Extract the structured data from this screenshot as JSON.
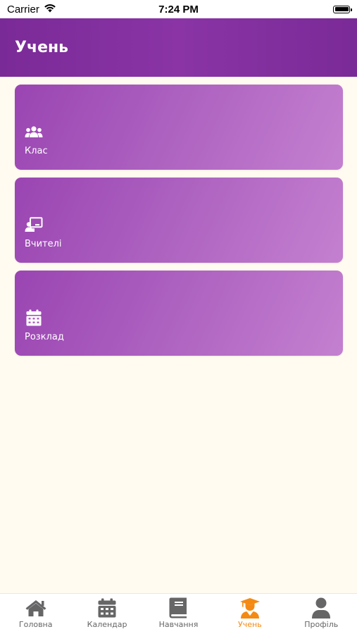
{
  "status_bar": {
    "carrier": "Carrier",
    "time": "7:24 PM"
  },
  "header": {
    "title": "Учень"
  },
  "cards": [
    {
      "label": "Клас",
      "icon": "users-icon"
    },
    {
      "label": "Вчителі",
      "icon": "teacher-board-icon"
    },
    {
      "label": "Розклад",
      "icon": "calendar-icon"
    }
  ],
  "tabbar": {
    "items": [
      {
        "label": "Головна",
        "icon": "home-icon",
        "active": false
      },
      {
        "label": "Календар",
        "icon": "calendar-icon",
        "active": false
      },
      {
        "label": "Навчання",
        "icon": "book-icon",
        "active": false
      },
      {
        "label": "Учень",
        "icon": "graduate-icon",
        "active": true
      },
      {
        "label": "Профіль",
        "icon": "user-icon",
        "active": false
      }
    ]
  },
  "colors": {
    "header": "#7a2a97",
    "card": "#b066c2",
    "background": "#fffbf0",
    "active_tab": "#f58a12",
    "inactive_tab": "#666666"
  }
}
